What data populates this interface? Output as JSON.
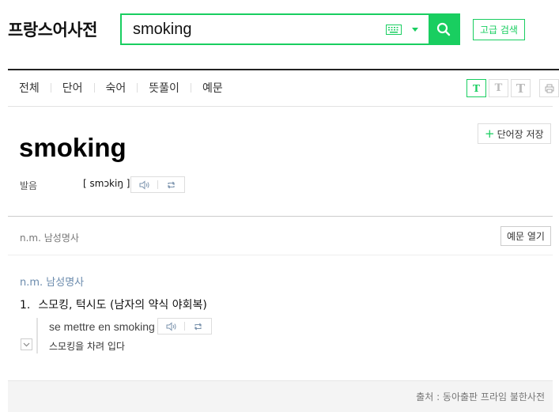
{
  "header": {
    "brand": "프랑스어사전",
    "search_value": "smoking",
    "advanced_search_label": "고급 검색"
  },
  "tabs": [
    "전체",
    "단어",
    "숙어",
    "뜻풀이",
    "예문"
  ],
  "view_tools": [
    "T",
    "T",
    "T"
  ],
  "entry": {
    "word": "smoking",
    "save_label": "단어장 저장",
    "pron_label": "발음",
    "pronunciation": "[ smɔkiŋ ]",
    "pos_summary": "n.m. 남성명사",
    "example_toggle_label": "예문 열기",
    "pos": "n.m. 남성명사",
    "meaning_number": "1.",
    "meaning": "스모킹, 턱시도 (남자의 약식 야회복)",
    "example_fr": "se mettre en smoking",
    "example_ko": "스모킹을 차려 입다"
  },
  "footer": {
    "source": "출처 : 동아출판 프라임 불한사전"
  },
  "colors": {
    "accent": "#19ce60",
    "pos_blue": "#6b8bad"
  }
}
